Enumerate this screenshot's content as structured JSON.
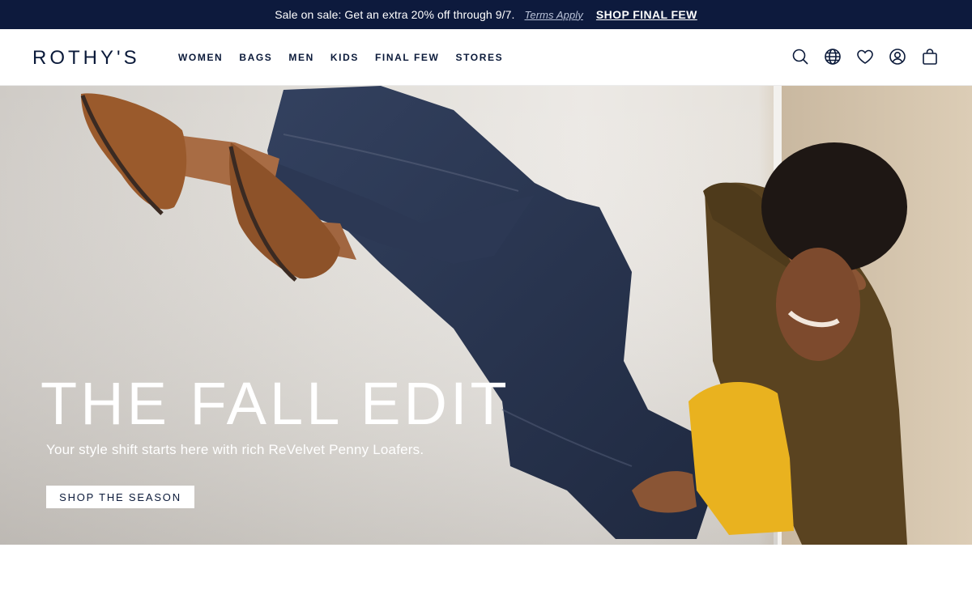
{
  "promo": {
    "text": "Sale on sale: Get an extra 20% off through 9/7.",
    "terms": "Terms Apply",
    "cta": "SHOP FINAL FEW"
  },
  "header": {
    "logo": "ROTHY'S",
    "nav": [
      "WOMEN",
      "BAGS",
      "MEN",
      "KIDS",
      "FINAL FEW",
      "STORES"
    ],
    "icons": [
      "search-icon",
      "globe-icon",
      "heart-icon",
      "account-icon",
      "bag-icon"
    ]
  },
  "hero": {
    "title": "THE FALL EDIT",
    "subtitle": "Your style shift starts here with rich ReVelvet Penny Loafers.",
    "cta": "SHOP THE SEASON"
  },
  "colors": {
    "navy": "#0d1a3d",
    "white": "#ffffff",
    "denim": "#2a3550",
    "loafer": "#9a5a2c",
    "sweater": "#e9b21f",
    "jacket": "#5a4320"
  }
}
